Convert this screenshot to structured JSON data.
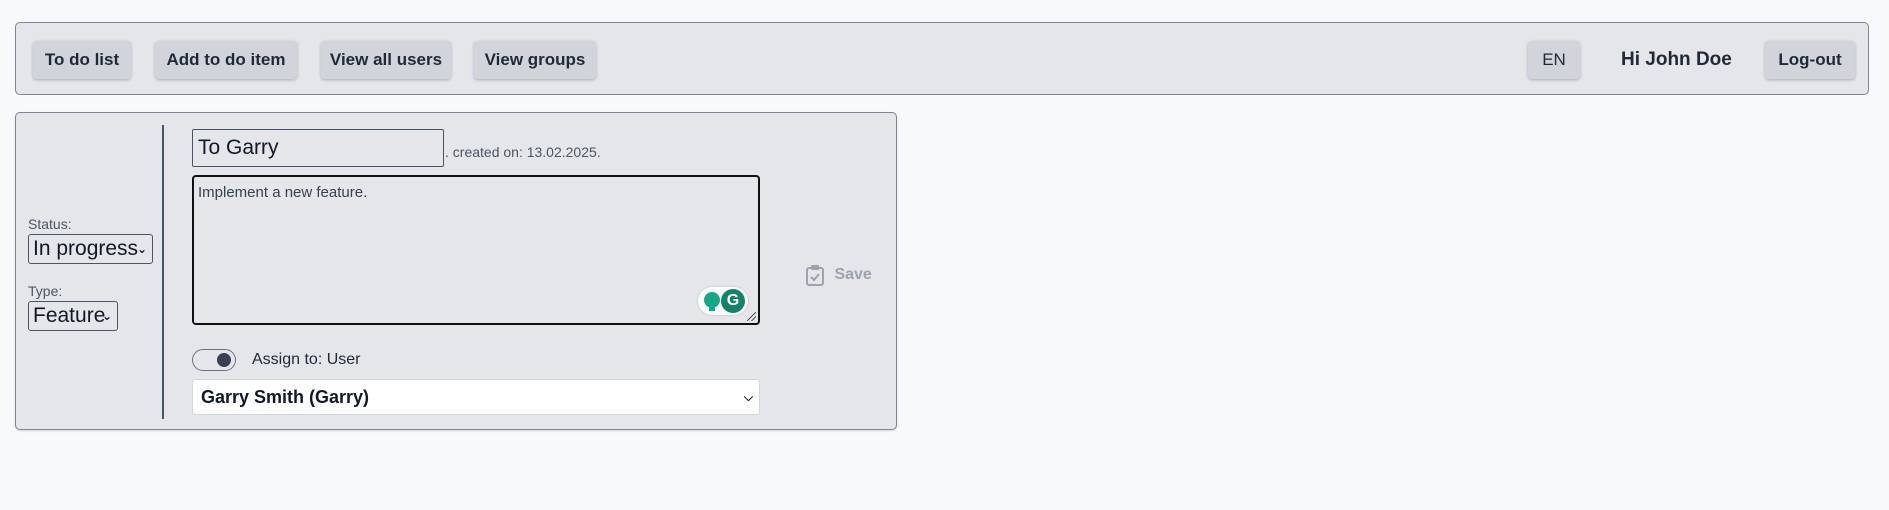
{
  "nav": {
    "todo_list": "To do list",
    "add_todo": "Add to do item",
    "view_users": "View all users",
    "view_groups": "View groups",
    "language": "EN",
    "greeting": "Hi John Doe",
    "logout": "Log-out"
  },
  "item": {
    "status_label": "Status:",
    "status_value": "In progress",
    "type_label": "Type:",
    "type_value": "Feature",
    "title": "To Garry",
    "created": ". created on: 13.02.2025.",
    "description": "Implement a new feature.",
    "save_label": "Save",
    "assign_label": "Assign to: User",
    "assignee": "Garry Smith (Garry)",
    "assign_toggle_on": true
  },
  "colors": {
    "accent_green": "#15a985",
    "border": "#7b8697",
    "panel_bg": "#e4e6ea"
  }
}
